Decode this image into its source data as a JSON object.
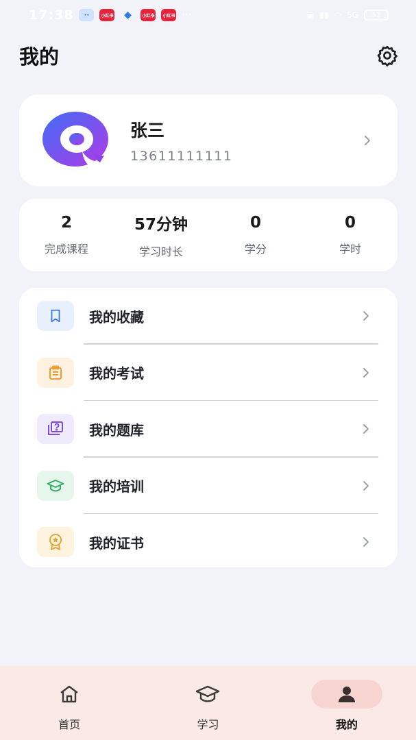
{
  "status_bar": {
    "time": "17:38",
    "apps": [
      {
        "label": "",
        "color": "#cfe2ff"
      },
      {
        "label": "小红书",
        "color": "#e8243c"
      },
      {
        "label": "",
        "color": "#ffffff"
      },
      {
        "label": "小红书",
        "color": "#e8243c"
      },
      {
        "label": "小红书",
        "color": "#e8243c"
      }
    ],
    "more": "···",
    "network": "5G",
    "battery": "52"
  },
  "header": {
    "title": "我的",
    "settings_icon": "gear-icon"
  },
  "profile": {
    "name": "张三",
    "phone": "13611111111",
    "avatar_colors": {
      "outer_start": "#4a6cf7",
      "outer_end": "#a239e8"
    }
  },
  "stats": [
    {
      "value": "2",
      "label": "完成课程"
    },
    {
      "value": "57分钟",
      "label": "学习时长"
    },
    {
      "value": "0",
      "label": "学分"
    },
    {
      "value": "0",
      "label": "学时"
    }
  ],
  "menu": [
    {
      "label": "我的收藏",
      "icon": "bookmark-icon",
      "bg": "#e8f0fe",
      "color": "#3a78e8"
    },
    {
      "label": "我的考试",
      "icon": "clipboard-icon",
      "bg": "#fff1e0",
      "color": "#f29a2e"
    },
    {
      "label": "我的题库",
      "icon": "question-bank-icon",
      "bg": "#efeafc",
      "color": "#7c4fe0"
    },
    {
      "label": "我的培训",
      "icon": "graduation-cap-icon",
      "bg": "#e6f6ec",
      "color": "#2fae64"
    },
    {
      "label": "我的证书",
      "icon": "award-badge-icon",
      "bg": "#fdf3de",
      "color": "#e6a43a"
    }
  ],
  "nav": [
    {
      "label": "首页",
      "icon": "home-icon",
      "active": false
    },
    {
      "label": "学习",
      "icon": "graduation-cap-icon",
      "active": false
    },
    {
      "label": "我的",
      "icon": "user-icon",
      "active": true
    }
  ]
}
